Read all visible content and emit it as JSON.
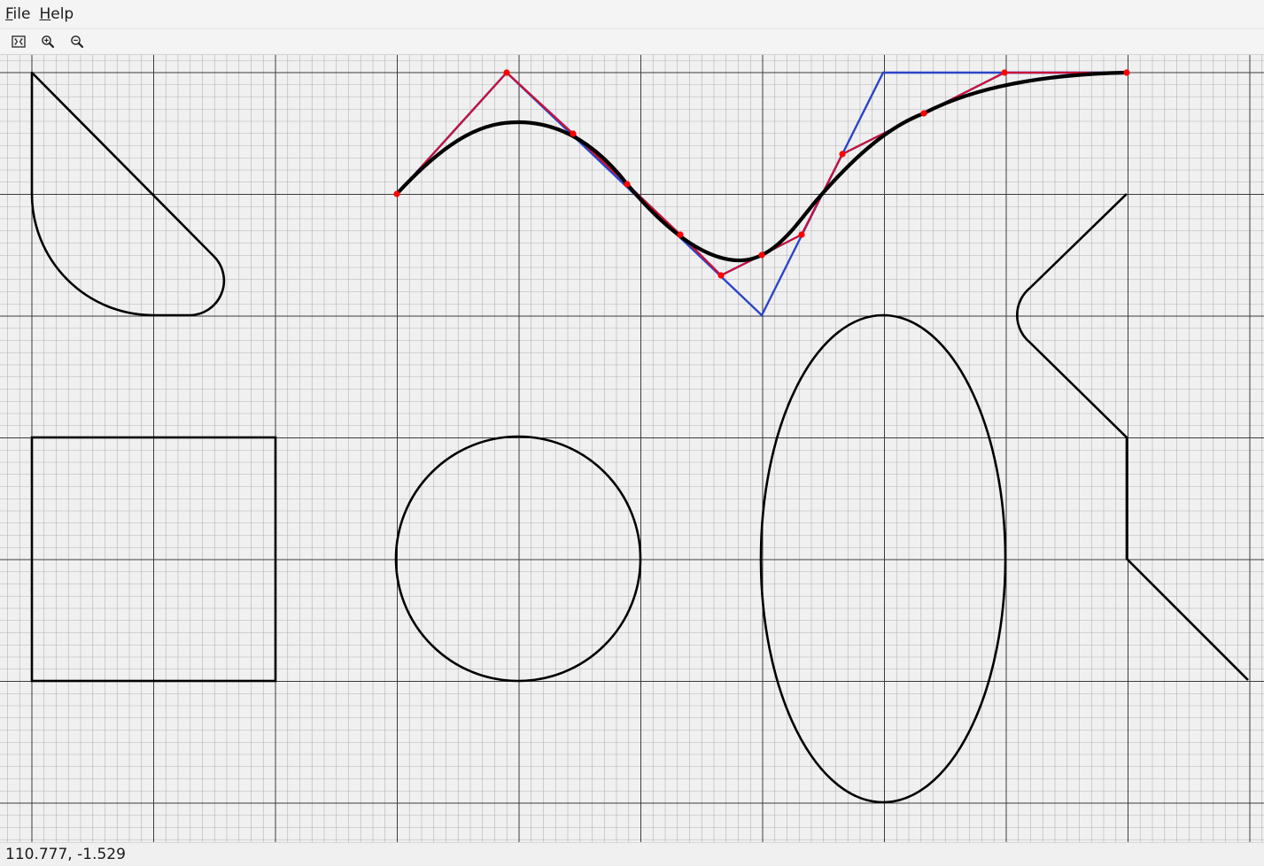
{
  "menu": {
    "file": {
      "mnemonic": "F",
      "rest": "ile"
    },
    "help": {
      "mnemonic": "H",
      "rest": "elp"
    }
  },
  "toolbar": {
    "fit_icon": "fit-to-window-icon",
    "zoom_in_icon": "zoom-in-icon",
    "zoom_out_icon": "zoom-out-icon"
  },
  "status": {
    "coordinates": "110.777, -1.529"
  },
  "colors": {
    "background": "#f0f0f0",
    "grid_minor": "#b4b4b4",
    "grid_major": "#3c3c3c",
    "shape_stroke": "#000000",
    "control_outer": "#2b45c8",
    "control_mid": "#7a2a8a",
    "control_inner": "#ff0000"
  }
}
